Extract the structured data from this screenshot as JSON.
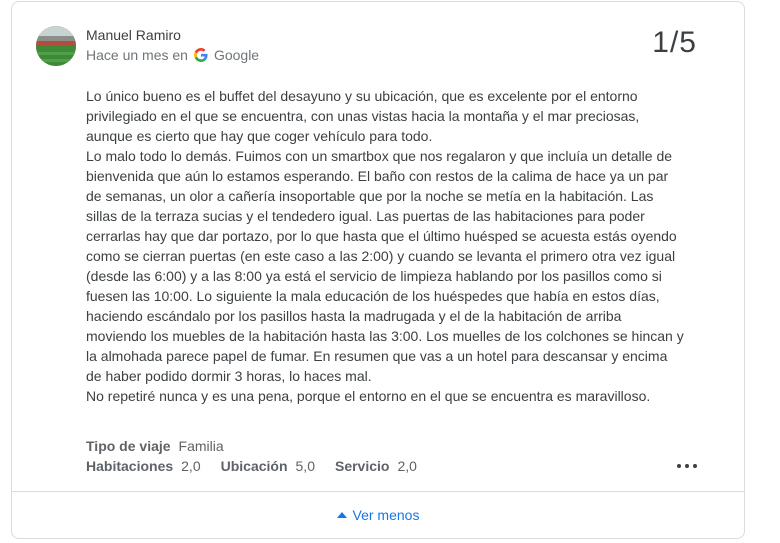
{
  "review": {
    "author": "Manuel Ramiro",
    "time_ago": "Hace un mes en",
    "source": "Google",
    "rating": "1/5",
    "paragraphs": [
      "Lo único bueno es el buffet del desayuno y su ubicación, que es excelente por el entorno privilegiado en el que se encuentra, con unas vistas hacia la montaña y el mar preciosas, aunque es cierto que hay que coger vehículo para todo.",
      "Lo malo todo lo demás. Fuimos con un smartbox que nos regalaron y que incluía un detalle de bienvenida que aún lo estamos esperando. El baño con restos de la calima de hace ya un par de semanas, un olor a cañería insoportable que por la noche se metía en la habitación. Las sillas de la terraza sucias y el tendedero igual. Las puertas de las habitaciones para poder cerrarlas hay que dar portazo, por lo que hasta que el último huésped se acuesta estás oyendo como se cierran puertas (en este caso a las 2:00) y cuando se levanta el primero otra vez igual (desde las 6:00) y a las 8:00 ya está el servicio de limpieza hablando por los pasillos como si fuesen las 10:00. Lo siguiente la mala educación de los huéspedes que había en estos días, haciendo escándalo por los pasillos hasta la madrugada y el de la habitación de arriba moviendo los muebles de la habitación hasta las 3:00. Los muelles de los colchones se hincan y la almohada parece papel de fumar. En resumen que vas a un hotel para descansar y encima de haber podido dormir 3 horas, lo haces mal.",
      "No repetiré nunca y es una pena, porque el entorno en el que se encuentra es maravilloso."
    ],
    "trip_type_label": "Tipo de viaje",
    "trip_type_value": "Familia",
    "scores": [
      {
        "label": "Habitaciones",
        "value": "2,0"
      },
      {
        "label": "Ubicación",
        "value": "5,0"
      },
      {
        "label": "Servicio",
        "value": "2,0"
      }
    ],
    "toggle_label": "Ver menos"
  },
  "colors": {
    "link": "#1a73e8",
    "text": "#3c4043",
    "border": "#dadce0"
  },
  "icons": {
    "avatar": "stadium-photo",
    "source": "google-g-icon",
    "more": "more-dots-icon",
    "toggle": "caret-up-icon"
  }
}
